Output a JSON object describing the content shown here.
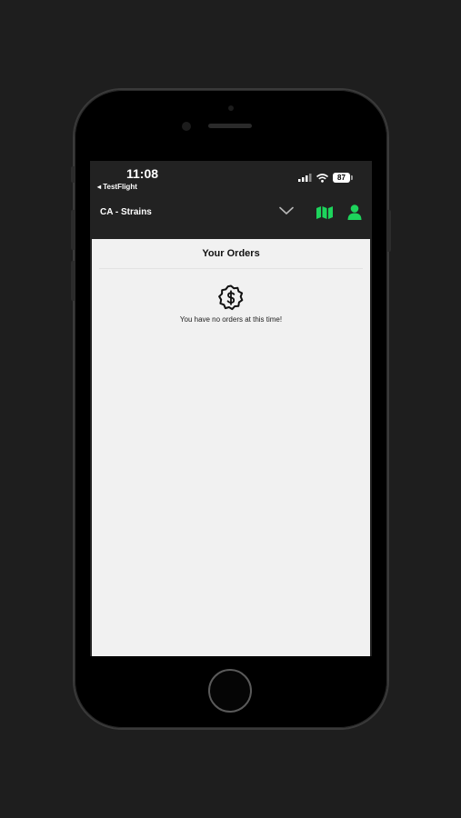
{
  "status_bar": {
    "time": "11:08",
    "back_app": "◂ TestFlight",
    "battery": "87",
    "icons": [
      "cellular-signal-icon",
      "wifi-icon",
      "battery-icon"
    ]
  },
  "header": {
    "location": "CA - Strains",
    "icons": [
      "chevron-down-icon",
      "map-icon",
      "profile-icon"
    ],
    "accent_color": "#1dd45c"
  },
  "orders": {
    "title": "Your Orders",
    "empty_message": "You have no orders at this time!",
    "empty_icon": "dollar-badge-icon"
  },
  "colors": {
    "background": "#1e1e1e",
    "screen_bar": "#222222",
    "content_bg": "#f1f1f1"
  }
}
